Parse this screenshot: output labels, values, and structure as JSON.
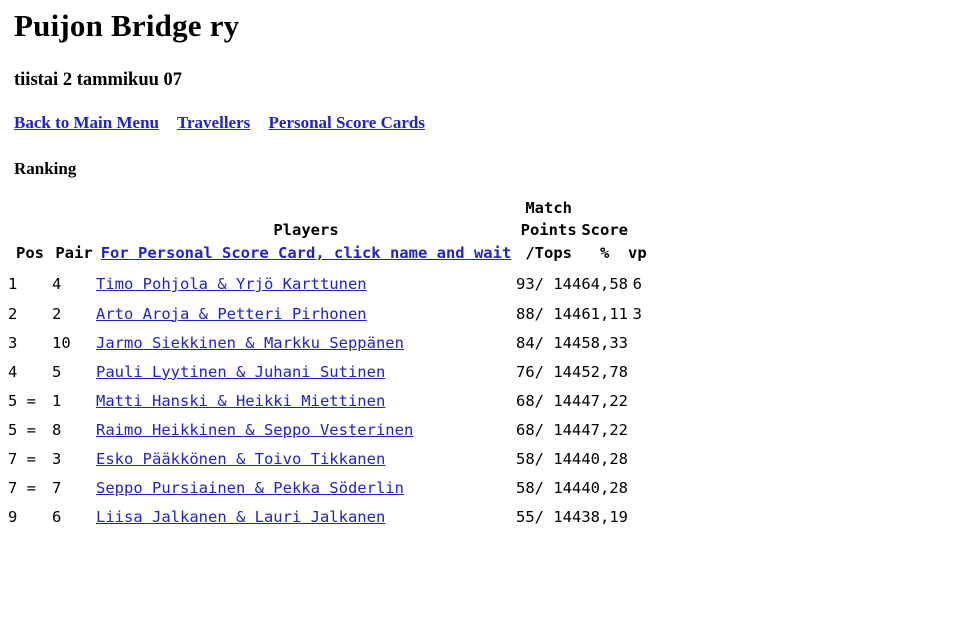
{
  "header": {
    "title": "Puijon Bridge ry",
    "date": "tiistai 2 tammikuu 07"
  },
  "nav": {
    "items": [
      {
        "label": "Back to Main Menu"
      },
      {
        "label": "Travellers"
      },
      {
        "label": "Personal Score Cards"
      }
    ]
  },
  "section": {
    "heading": "Ranking"
  },
  "table": {
    "headers": {
      "pos": "Pos",
      "pair": "Pair",
      "players_title": "Players",
      "players_link": "For Personal Score Card, click name and wait",
      "match_line1": "Match",
      "match_line2": "Points",
      "match_line3": "/Tops",
      "score_line1": "Score",
      "score_line2": "%",
      "vp": "vp"
    },
    "rows": [
      {
        "pos": "1",
        "pair": "4",
        "players": "Timo Pohjola & Yrjö Karttunen",
        "match": "93/ 144",
        "score": "64,58",
        "vp": "6"
      },
      {
        "pos": "2",
        "pair": "2",
        "players": "Arto Aroja & Petteri Pirhonen",
        "match": "88/ 144",
        "score": "61,11",
        "vp": "3"
      },
      {
        "pos": "3",
        "pair": "10",
        "players": "Jarmo Siekkinen & Markku Seppänen",
        "match": "84/ 144",
        "score": "58,33",
        "vp": ""
      },
      {
        "pos": "4",
        "pair": "5",
        "players": "Pauli Lyytinen & Juhani Sutinen",
        "match": "76/ 144",
        "score": "52,78",
        "vp": ""
      },
      {
        "pos": "5 =",
        "pair": "1",
        "players": "Matti Hanski & Heikki Miettinen",
        "match": "68/ 144",
        "score": "47,22",
        "vp": ""
      },
      {
        "pos": "5 =",
        "pair": "8",
        "players": "Raimo Heikkinen & Seppo Vesterinen",
        "match": "68/ 144",
        "score": "47,22",
        "vp": ""
      },
      {
        "pos": "7 =",
        "pair": "3",
        "players": "Esko Pääkkönen & Toivo Tikkanen",
        "match": "58/ 144",
        "score": "40,28",
        "vp": ""
      },
      {
        "pos": "7 =",
        "pair": "7",
        "players": "Seppo Pursiainen & Pekka Söderlin",
        "match": "58/ 144",
        "score": "40,28",
        "vp": ""
      },
      {
        "pos": "9",
        "pair": "6",
        "players": "Liisa Jalkanen & Lauri Jalkanen",
        "match": "55/ 144",
        "score": "38,19",
        "vp": ""
      }
    ]
  },
  "colors": {
    "link": "#2222cc",
    "text": "#000000",
    "background": "#ffffff"
  }
}
